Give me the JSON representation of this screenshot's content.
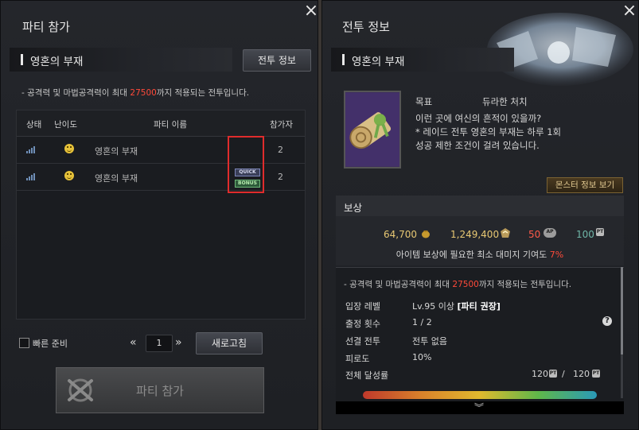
{
  "left": {
    "title": "파티 참가",
    "section_title": "영혼의 부재",
    "battle_info_button": "전투 정보",
    "notice": {
      "prefix": "- 공격력 및 마법공격력이 최대 ",
      "value": "27500",
      "suffix": "까지 적용되는 전투입니다."
    },
    "table": {
      "headers": [
        "상태",
        "난이도",
        "파티 이름",
        "참가자"
      ],
      "rows": [
        {
          "name": "영혼의 부재",
          "count": "2",
          "badges": []
        },
        {
          "name": "영혼의 부재",
          "count": "2",
          "badges": [
            "QUICK",
            "BONUS"
          ]
        }
      ]
    },
    "quick_ready_label": "빠른 준비",
    "pager": {
      "prev": "«",
      "page": "1",
      "next": "»"
    },
    "refresh_button": "새로고침",
    "join_button": "파티 참가"
  },
  "right": {
    "title": "전투 정보",
    "section_title": "영혼의 부재",
    "goal_label": "목표",
    "goal_value": "듀라한 처치",
    "description": [
      "이런 곳에 여신의 흔적이 있을까?",
      "* 레이드 전투 영혼의 부재는 하루 1회",
      "성공 제한 조건이 걸려 있습니다."
    ],
    "monster_info_button": "몬스터 정보 보기",
    "reward": {
      "header": "보상",
      "gold": "64,700",
      "exp": "1,249,400",
      "ap": "50",
      "ap_icon_label": "AP",
      "pt": "100",
      "pt_icon_label": "PT",
      "min_damage_text": "아이템 보상에 필요한 최소 대미지 기여도",
      "min_damage_value": "7%"
    },
    "detail": {
      "notice": {
        "prefix": "- 공격력 및 마법공격력이 최대 ",
        "value": "27500",
        "suffix": "까지 적용되는 전투입니다."
      },
      "rows": [
        {
          "label": "입장 레벨",
          "value": "Lv.95 이상",
          "extra": "[파티 권장]"
        },
        {
          "label": "출정 횟수",
          "value": "1 / 2"
        },
        {
          "label": "선결 전투",
          "value": "전투 없음"
        },
        {
          "label": "피로도",
          "value": "10%"
        },
        {
          "label": "전체 달성률",
          "value": ""
        }
      ],
      "achievement": {
        "current": "120",
        "sep": "/",
        "max": "120"
      }
    },
    "scroll_down_label": "︾"
  },
  "colors": {
    "highlight": "#ff4a3a",
    "annotation_box": "#e02c2c"
  },
  "close_icon": "×"
}
